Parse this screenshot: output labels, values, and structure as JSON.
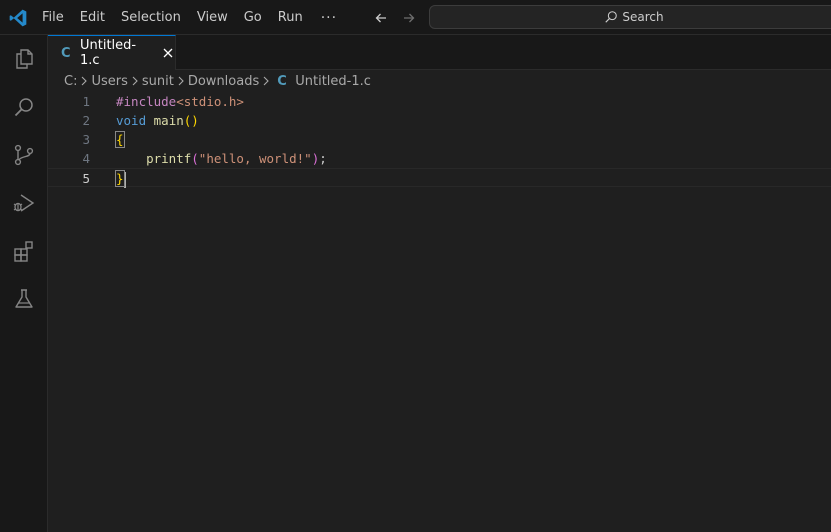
{
  "menu": [
    "File",
    "Edit",
    "Selection",
    "View",
    "Go",
    "Run",
    "···"
  ],
  "search": {
    "label": "Search"
  },
  "tab": {
    "label": "Untitled-1.c",
    "glyph": "C"
  },
  "breadcrumb": {
    "parts": [
      "C:",
      "Users",
      "sunit",
      "Downloads"
    ],
    "file": "Untitled-1.c",
    "glyph": "C"
  },
  "editor": {
    "lines": [
      {
        "number": "1",
        "tokens": [
          {
            "t": "#include",
            "c": "kw-pp"
          },
          {
            "t": "<stdio.h>",
            "c": "inc"
          }
        ]
      },
      {
        "number": "2",
        "tokens": [
          {
            "t": "void",
            "c": "kw"
          },
          {
            "t": " ",
            "c": "punct"
          },
          {
            "t": "main",
            "c": "fn"
          },
          {
            "t": "()",
            "c": "paren"
          }
        ]
      },
      {
        "number": "3",
        "tokens": [
          {
            "t": "{",
            "c": "paren"
          }
        ]
      },
      {
        "number": "4",
        "tokens": [
          {
            "t": "    ",
            "c": "punct"
          },
          {
            "t": "printf",
            "c": "fn"
          },
          {
            "t": "(",
            "c": "paren2"
          },
          {
            "t": "\"hello, world!\"",
            "c": "str"
          },
          {
            "t": ")",
            "c": "paren2"
          },
          {
            "t": ";",
            "c": "punct"
          }
        ]
      },
      {
        "number": "5",
        "tokens": [
          {
            "t": "}",
            "c": "paren"
          }
        ]
      }
    ],
    "active_line": 5
  },
  "colors": {
    "accent": "#0078d4",
    "background": "#1f1f1f",
    "chrome": "#181818"
  },
  "icons": [
    "vscode-logo-icon",
    "arrow-left-icon",
    "arrow-right-icon",
    "search-icon",
    "explorer-icon",
    "search-view-icon",
    "source-control-icon",
    "run-debug-icon",
    "extensions-icon",
    "testing-icon",
    "close-icon",
    "chevron-right-icon"
  ]
}
